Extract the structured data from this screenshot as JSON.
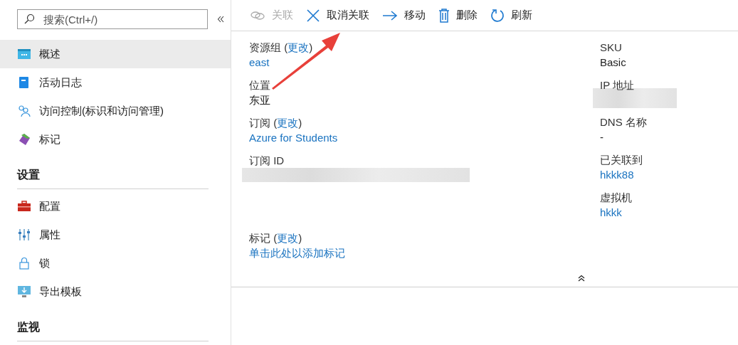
{
  "sidebar": {
    "search": {
      "placeholder": "搜索(Ctrl+/)"
    },
    "groups": [
      {
        "items": [
          {
            "label": "概述",
            "selected": true
          },
          {
            "label": "活动日志",
            "selected": false
          },
          {
            "label": "访问控制(标识和访问管理)",
            "selected": false
          },
          {
            "label": "标记",
            "selected": false
          }
        ]
      },
      {
        "heading": "设置",
        "items": [
          {
            "label": "配置",
            "selected": false
          },
          {
            "label": "属性",
            "selected": false
          },
          {
            "label": "锁",
            "selected": false
          },
          {
            "label": "导出模板",
            "selected": false
          }
        ]
      },
      {
        "heading": "监视"
      }
    ]
  },
  "toolbar": [
    {
      "label": "关联",
      "disabled": true
    },
    {
      "label": "取消关联",
      "disabled": false
    },
    {
      "label": "移动",
      "disabled": false
    },
    {
      "label": "删除",
      "disabled": false
    },
    {
      "label": "刷新",
      "disabled": false
    }
  ],
  "essentials": {
    "left": [
      {
        "label": "资源组 (",
        "change": "更改",
        "label_end": ")",
        "kind": "link",
        "value": "east"
      },
      {
        "label": "位置",
        "kind": "text",
        "value": "东亚"
      },
      {
        "label": "订阅 (",
        "change": "更改",
        "label_end": ")",
        "kind": "link",
        "value": "Azure for Students"
      },
      {
        "label": "订阅 ID",
        "kind": "redacted"
      }
    ],
    "right": [
      {
        "label": "SKU",
        "kind": "text",
        "value": "Basic"
      },
      {
        "label": "IP 地址",
        "kind": "redacted"
      },
      {
        "label": "DNS 名称",
        "kind": "text",
        "value": "-"
      },
      {
        "label": "已关联到",
        "kind": "link",
        "value": "hkkk88"
      },
      {
        "label": "虚拟机",
        "kind": "link",
        "value": "hkkk"
      }
    ],
    "tags": {
      "label": "标记 (",
      "change": "更改",
      "label_end": ")",
      "kind": "link",
      "value": "单击此处以添加标记"
    }
  }
}
